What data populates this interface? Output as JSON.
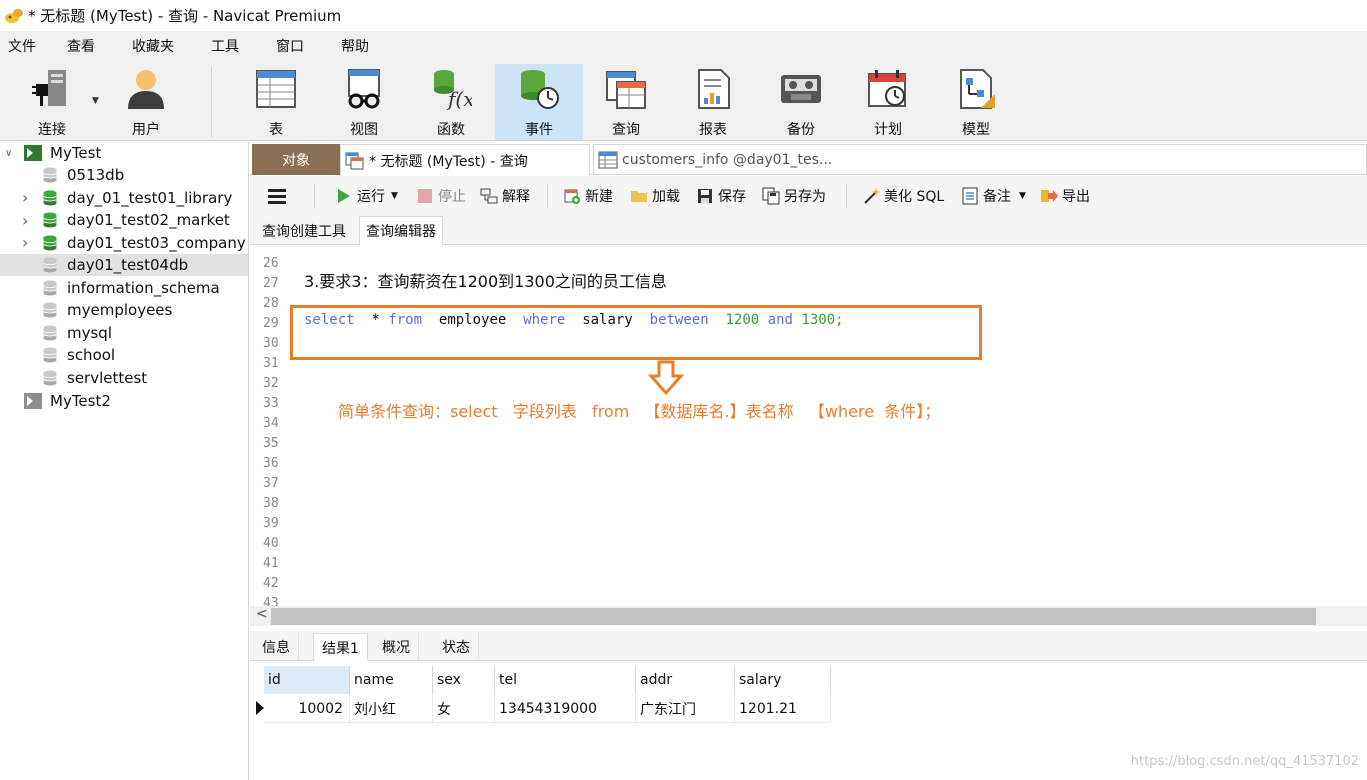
{
  "window": {
    "title": "* 无标题 (MyTest) - 查询 - Navicat Premium"
  },
  "menu": [
    "文件",
    "查看",
    "收藏夹",
    "工具",
    "窗口",
    "帮助"
  ],
  "toolbar": {
    "connect": "连接",
    "user": "用户",
    "table": "表",
    "view": "视图",
    "function": "函数",
    "event": "事件",
    "query": "查询",
    "report": "报表",
    "backup": "备份",
    "schedule": "计划",
    "model": "模型"
  },
  "nav": {
    "connection1": "MyTest",
    "databases": [
      {
        "name": "0513db",
        "open": false,
        "expandable": false
      },
      {
        "name": "day_01_test01_library",
        "open": true,
        "expandable": true
      },
      {
        "name": "day01_test02_market",
        "open": true,
        "expandable": true
      },
      {
        "name": "day01_test03_company",
        "open": true,
        "expandable": true
      },
      {
        "name": "day01_test04db",
        "open": false,
        "expandable": false,
        "selected": true
      },
      {
        "name": "information_schema",
        "open": false,
        "expandable": false
      },
      {
        "name": "myemployees",
        "open": false,
        "expandable": false
      },
      {
        "name": "mysql",
        "open": false,
        "expandable": false
      },
      {
        "name": "school",
        "open": false,
        "expandable": false
      },
      {
        "name": "servlettest",
        "open": false,
        "expandable": false
      }
    ],
    "connection2": "MyTest2"
  },
  "tabs": {
    "objects": "对象",
    "query_tab": "* 无标题 (MyTest) - 查询",
    "table_tab": "customers_info @day01_tes..."
  },
  "query_toolbar": {
    "run": "运行",
    "stop": "停止",
    "explain": "解释",
    "new": "新建",
    "load": "加载",
    "save": "保存",
    "save_as": "另存为",
    "beautify": "美化 SQL",
    "note": "备注",
    "export": "导出"
  },
  "editor_tabs": {
    "builder": "查询创建工具",
    "editor": "查询编辑器"
  },
  "editor": {
    "line_numbers": [
      "26",
      "27",
      "28",
      "29",
      "30",
      "31",
      "32",
      "33",
      "34",
      "35",
      "36",
      "37",
      "38",
      "39",
      "40",
      "41",
      "42",
      "43"
    ],
    "comment": "3.要求3：查询薪资在1200到1300之间的员工信息",
    "sql": {
      "select": "select",
      "star": "*",
      "from": "from",
      "table": "employee",
      "where": "where",
      "column": "salary",
      "between": "between",
      "low": "1200",
      "and": "and",
      "high": "1300;"
    },
    "annotation": "简单条件查询：select   字段列表   from   【数据库名.】表名称   【where  条件】；"
  },
  "result_tabs": [
    "信息",
    "结果1",
    "概况",
    "状态"
  ],
  "grid": {
    "columns": [
      "id",
      "name",
      "sex",
      "tel",
      "addr",
      "salary"
    ],
    "rows": [
      [
        "10002",
        "刘小红",
        "女",
        "13454319000",
        "广东江门",
        "1201.21"
      ]
    ]
  },
  "watermark": "https://blog.csdn.net/qq_41537102",
  "colors": {
    "annotation": "#ea7d2c",
    "keyword": "#5a6fd6",
    "number": "#3c9a3c",
    "objects_tab": "#8b6f55"
  }
}
